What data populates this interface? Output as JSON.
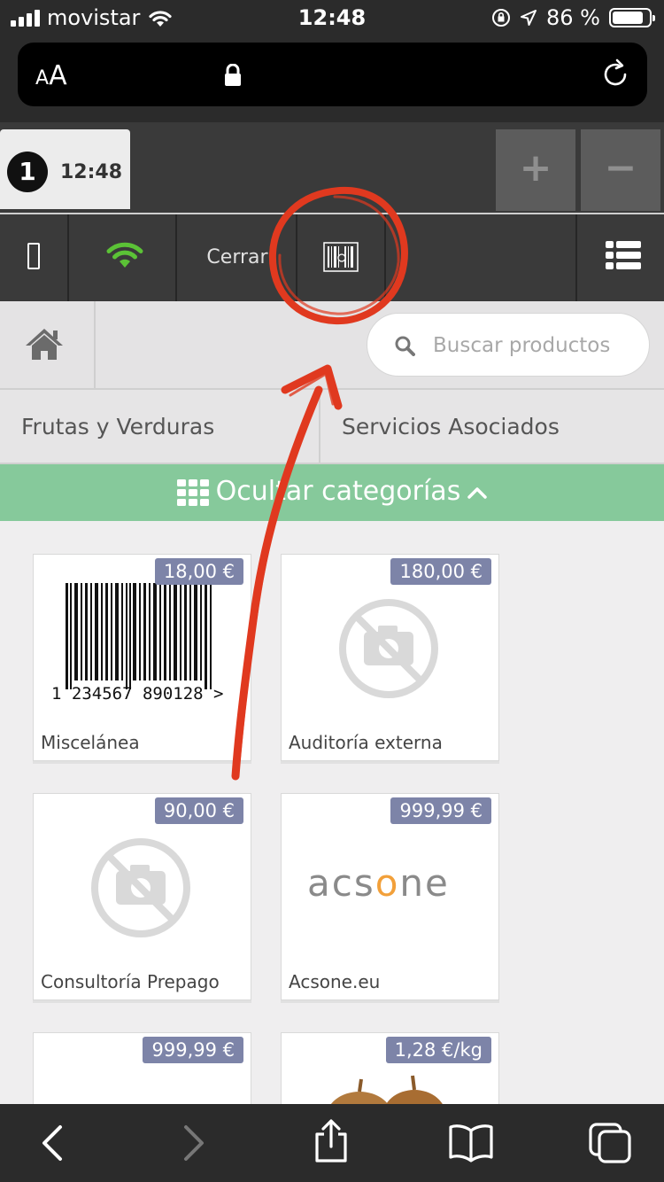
{
  "status_bar": {
    "carrier": "movistar",
    "time": "12:48",
    "battery_text": "86 %",
    "battery_level": 0.86
  },
  "browser": {
    "text_size_label_small": "A",
    "text_size_label_large": "A",
    "icons": [
      "lock-icon",
      "reload-icon"
    ]
  },
  "app_toolbar": {
    "ticket_number": "1",
    "ticket_time": "12:48",
    "plus_label": "+",
    "minus_label": "−",
    "close_label": "Cerrar"
  },
  "search": {
    "placeholder": "Buscar productos"
  },
  "categories": [
    {
      "label": "Frutas y Verduras"
    },
    {
      "label": "Servicios Asociados"
    }
  ],
  "toggle_categories_label": "Ocultar categorías",
  "barcode_digits": "1 234567 890128 >",
  "acsone_logo": {
    "part1": "acs",
    "part2": "o",
    "part3": "ne"
  },
  "products": [
    {
      "name": "Miscelánea",
      "price": "18,00 €",
      "image": "barcode"
    },
    {
      "name": "Auditoría externa",
      "price": "180,00 €",
      "image": "no-image"
    },
    {
      "name": "Consultoría Prepago",
      "price": "90,00 €",
      "image": "no-image"
    },
    {
      "name": "Acsone.eu",
      "price": "999,99 €",
      "image": "acsone-logo"
    },
    {
      "name": "",
      "price": "999,99 €",
      "image": "blank"
    },
    {
      "name": "",
      "price": "1,28 €/kg",
      "image": "onions"
    }
  ],
  "colors": {
    "dark_bar": "#3a3a3a",
    "category_toggle": "#86c99b",
    "price_badge": "#7d84a8",
    "wifi_ok": "#5bc236",
    "annotation": "#e0391f"
  }
}
